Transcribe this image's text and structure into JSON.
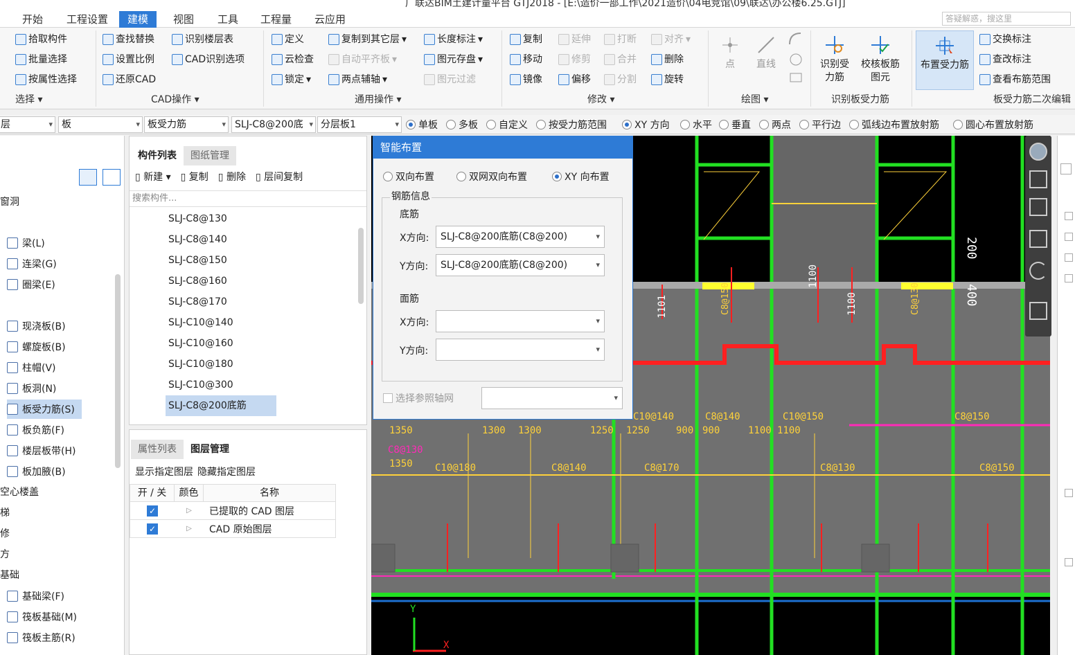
{
  "window": {
    "title": "广联达BIM土建计量平台 GTJ2018 - [E:\\造价一部工作\\2021造价\\04电竞馆\\09\\联达\\办公楼6.25.GTJ]"
  },
  "menu": {
    "tabs": [
      "开始",
      "工程设置",
      "建模",
      "视图",
      "工具",
      "工程量",
      "云应用"
    ],
    "active": "建模",
    "search_placeholder": "答疑解惑，搜这里"
  },
  "ribbon": {
    "select": {
      "items": [
        "拾取构件",
        "批量选择",
        "按属性选择"
      ],
      "label": "选择"
    },
    "cad": {
      "items": [
        "查找替换",
        "识别楼层表",
        "设置比例",
        "CAD识别选项",
        "还原CAD"
      ],
      "label": "CAD操作"
    },
    "common": {
      "items": [
        "定义",
        "复制到其它层",
        "长度标注",
        "云检查",
        "自动平齐板",
        "图元存盘",
        "锁定",
        "两点辅轴",
        "图元过滤"
      ],
      "label": "通用操作"
    },
    "modify": {
      "items": [
        "复制",
        "延伸",
        "打断",
        "对齐",
        "移动",
        "修剪",
        "合并",
        "删除",
        "镜像",
        "偏移",
        "分割",
        "旋转"
      ],
      "label": "修改"
    },
    "draw": {
      "items": [
        "点",
        "直线"
      ],
      "label": "绘图"
    },
    "identify": {
      "items": [
        "识别受力筋",
        "校核板筋图元"
      ],
      "label": "识别板受力筋"
    },
    "second": {
      "items": [
        "布置受力筋",
        "交换标注",
        "查改标注",
        "查看布筋范围"
      ],
      "label": "板受力筋二次编辑"
    }
  },
  "context": {
    "dropdowns": [
      "层",
      "板",
      "板受力筋",
      "SLJ-C8@200底",
      "分层板1"
    ],
    "radios": [
      "单板",
      "多板",
      "自定义",
      "按受力筋范围",
      "XY 方向",
      "水平",
      "垂直",
      "两点",
      "平行边",
      "弧线边布置放射筋",
      "圆心布置放射筋"
    ],
    "checked": [
      "单板",
      "XY 方向"
    ]
  },
  "leftpanel": {
    "categories": [
      "窗洞",
      "板",
      "基础"
    ],
    "partial": [
      "梯",
      "修",
      "方"
    ],
    "items": [
      "梁(L)",
      "连梁(G)",
      "圈梁(E)",
      "现浇板(B)",
      "螺旋板(B)",
      "柱帽(V)",
      "板洞(N)",
      "板受力筋(S)",
      "板负筋(F)",
      "楼层板带(H)",
      "板加腋(B)",
      "空心楼盖",
      "基础梁(F)",
      "筏板基础(M)",
      "筏板主筋(R)"
    ],
    "selected": "板受力筋(S)"
  },
  "complist": {
    "tabs": [
      "构件列表",
      "图纸管理"
    ],
    "toolbar": [
      "新建",
      "复制",
      "删除",
      "层间复制"
    ],
    "search_placeholder": "搜索构件...",
    "items": [
      "SLJ-C8@130",
      "SLJ-C8@140",
      "SLJ-C8@150",
      "SLJ-C8@160",
      "SLJ-C8@170",
      "SLJ-C10@140",
      "SLJ-C10@160",
      "SLJ-C10@180",
      "SLJ-C10@300",
      "SLJ-C8@200底筋"
    ],
    "selected": "SLJ-C8@200底筋"
  },
  "proppanel": {
    "tabs": [
      "属性列表",
      "图层管理"
    ],
    "actions": [
      "显示指定图层",
      "隐藏指定图层"
    ],
    "columns": [
      "开 / 关",
      "颜色",
      "名称"
    ],
    "rows": [
      "已提取的 CAD 图层",
      "CAD 原始图层"
    ]
  },
  "dialog": {
    "title": "智能布置",
    "modes": [
      "双向布置",
      "双网双向布置",
      "XY 向布置"
    ],
    "mode_selected": "XY 向布置",
    "group": "钢筋信息",
    "bottom": "底筋",
    "top": "面筋",
    "x_label": "X方向:",
    "y_label": "Y方向:",
    "bottom_x": "SLJ-C8@200底筋(C8@200)",
    "bottom_y": "SLJ-C8@200底筋(C8@200)",
    "top_x": "",
    "top_y": "",
    "axis_checkbox": "选择参照轴网"
  },
  "canvas": {
    "labels": [
      "C8@140",
      "C8@150",
      "C8@130",
      "C10@180",
      "C8@140",
      "C8@170",
      "C8@130",
      "C8@150",
      "C10@140",
      "C10@150",
      "1350",
      "1300",
      "1300",
      "1250",
      "1250",
      "900",
      "900",
      "1100",
      "1100",
      "1350",
      "200",
      "400",
      "1101",
      "1100",
      "1100",
      "C8@150",
      "C8@130"
    ],
    "axis_x": "X",
    "axis_y": "Y"
  },
  "colors": {
    "accent": "#2e7bd6",
    "green": "#22e022",
    "red": "#ff2020",
    "magenta": "#ff2ab8",
    "yellow": "#ffd23a"
  }
}
